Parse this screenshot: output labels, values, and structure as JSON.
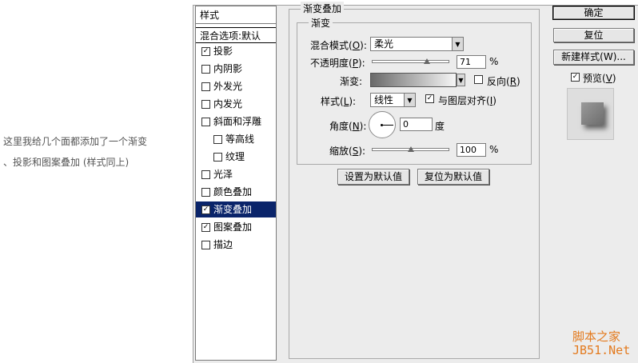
{
  "caption": {
    "line1": "这里我给几个面都添加了一个渐变",
    "line2": "、投影和图案叠加 (样式同上)"
  },
  "style_list": {
    "header": "样式",
    "blending_options": "混合选项:默认",
    "items": [
      {
        "label": "投影",
        "checked": true,
        "indent": false,
        "selected": false
      },
      {
        "label": "内阴影",
        "checked": false,
        "indent": false,
        "selected": false
      },
      {
        "label": "外发光",
        "checked": false,
        "indent": false,
        "selected": false
      },
      {
        "label": "内发光",
        "checked": false,
        "indent": false,
        "selected": false
      },
      {
        "label": "斜面和浮雕",
        "checked": false,
        "indent": false,
        "selected": false
      },
      {
        "label": "等高线",
        "checked": false,
        "indent": true,
        "selected": false
      },
      {
        "label": "纹理",
        "checked": false,
        "indent": true,
        "selected": false
      },
      {
        "label": "光泽",
        "checked": false,
        "indent": false,
        "selected": false
      },
      {
        "label": "颜色叠加",
        "checked": false,
        "indent": false,
        "selected": false
      },
      {
        "label": "渐变叠加",
        "checked": true,
        "indent": false,
        "selected": true
      },
      {
        "label": "图案叠加",
        "checked": true,
        "indent": false,
        "selected": false
      },
      {
        "label": "描边",
        "checked": false,
        "indent": false,
        "selected": false
      }
    ]
  },
  "panel": {
    "outer_title": "渐变叠加",
    "inner_title": "渐变",
    "blend_mode": {
      "label": "混合模式(",
      "key": "O",
      "suffix": "):",
      "value": "柔光"
    },
    "opacity": {
      "label": "不透明度(",
      "key": "P",
      "suffix": "):",
      "value": "71",
      "unit": "%",
      "level": 0.71
    },
    "gradient": {
      "label": "渐变:",
      "reverse": {
        "label": "反向(",
        "key": "R",
        "suffix": ")",
        "checked": false
      }
    },
    "style": {
      "label": "样式(",
      "key": "L",
      "suffix": "):",
      "value": "线性",
      "align": {
        "label": "与图层对齐(",
        "key": "I",
        "suffix": ")",
        "checked": true
      }
    },
    "angle": {
      "label": "角度(",
      "key": "N",
      "suffix": "):",
      "value": "0",
      "unit": "度"
    },
    "scale": {
      "label": "缩放(",
      "key": "S",
      "suffix": "):",
      "value": "100",
      "unit": "%",
      "level": 0.5
    },
    "set_default": "设置为默认值",
    "reset_default": "复位为默认值"
  },
  "buttons": {
    "ok": "确定",
    "reset": "复位",
    "new_style": "新建样式(W)...",
    "preview": {
      "label": "预览(",
      "key": "V",
      "suffix": ")",
      "checked": true
    }
  },
  "watermark": {
    "line1": "脚本之家",
    "line2": "JB51.Net"
  },
  "colors": {
    "selection": "#0a246a",
    "dialog_bg": "#ececec",
    "watermark": "#e37a1e"
  },
  "icons": {
    "check": "✓",
    "dropdown": "▼"
  }
}
